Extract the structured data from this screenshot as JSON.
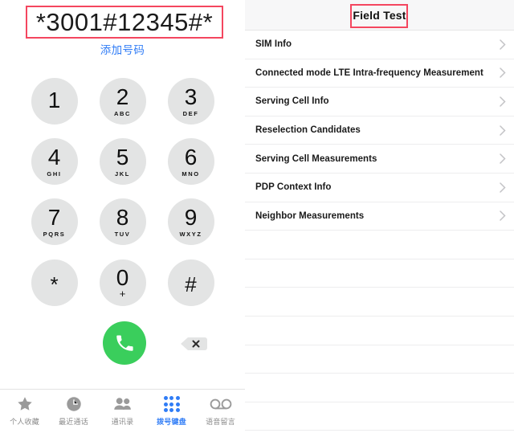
{
  "dialer": {
    "dialed_number": "*3001#12345#*",
    "add_number_label": "添加号码",
    "annotation_color": "#f4465f",
    "accent_color": "#2f7cf6",
    "call_button_color": "#3ace5c",
    "key_background": "#e3e4e4",
    "keys": [
      {
        "digit": "1",
        "letters": ""
      },
      {
        "digit": "2",
        "letters": "ABC"
      },
      {
        "digit": "3",
        "letters": "DEF"
      },
      {
        "digit": "4",
        "letters": "GHI"
      },
      {
        "digit": "5",
        "letters": "JKL"
      },
      {
        "digit": "6",
        "letters": "MNO"
      },
      {
        "digit": "7",
        "letters": "PQRS"
      },
      {
        "digit": "8",
        "letters": "TUV"
      },
      {
        "digit": "9",
        "letters": "WXYZ"
      },
      {
        "digit": "*",
        "letters": ""
      },
      {
        "digit": "0",
        "letters": "+"
      },
      {
        "digit": "#",
        "letters": ""
      }
    ],
    "call_button_icon": "phone-icon",
    "delete_button_icon": "backspace-icon",
    "tabs": [
      {
        "label": "个人收藏",
        "icon": "star-icon",
        "active": false
      },
      {
        "label": "最近通话",
        "icon": "clock-icon",
        "active": false
      },
      {
        "label": "通讯录",
        "icon": "contacts-icon",
        "active": false
      },
      {
        "label": "拨号键盘",
        "icon": "keypad-icon",
        "active": true
      },
      {
        "label": "语音留言",
        "icon": "voicemail-icon",
        "active": false
      }
    ]
  },
  "field_test": {
    "title": "Field Test",
    "title_annotation_color": "#f4465f",
    "rows": [
      {
        "label": "SIM Info"
      },
      {
        "label": "Connected mode LTE Intra-frequency Measurement"
      },
      {
        "label": "Serving Cell Info"
      },
      {
        "label": "Reselection Candidates"
      },
      {
        "label": "Serving Cell Measurements"
      },
      {
        "label": "PDP Context Info"
      },
      {
        "label": "Neighbor Measurements"
      }
    ],
    "empty_row_count": 7,
    "chevron_icon": "chevron-right-icon"
  }
}
